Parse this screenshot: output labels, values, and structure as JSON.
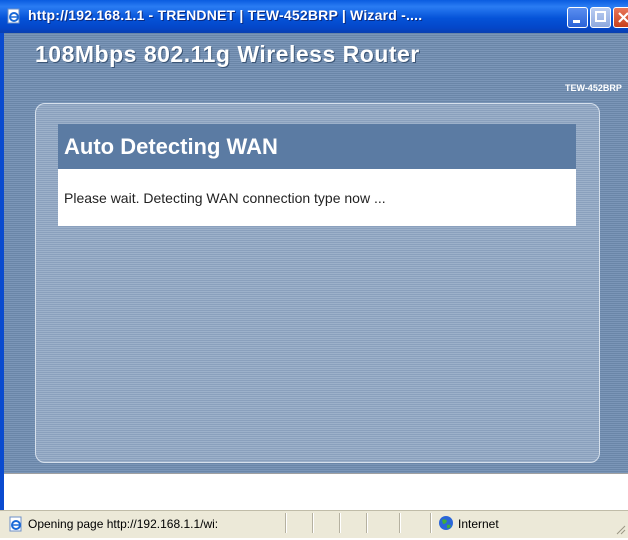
{
  "window": {
    "title": "http://192.168.1.1 - TRENDNET | TEW-452BRP | Wizard -....",
    "icon": "ie-page-icon"
  },
  "router": {
    "product_title": "108Mbps 802.11g Wireless Router",
    "model": "TEW-452BRP"
  },
  "section": {
    "title": "Auto Detecting WAN",
    "message": "Please wait. Detecting WAN connection type now ..."
  },
  "status_bar": {
    "text": "Opening page http://192.168.1.1/wi:",
    "zone": "Internet"
  },
  "colors": {
    "titlebar": "#0553d8",
    "content_bg": "#7b96b8",
    "header_bg": "#5b7ba3"
  }
}
